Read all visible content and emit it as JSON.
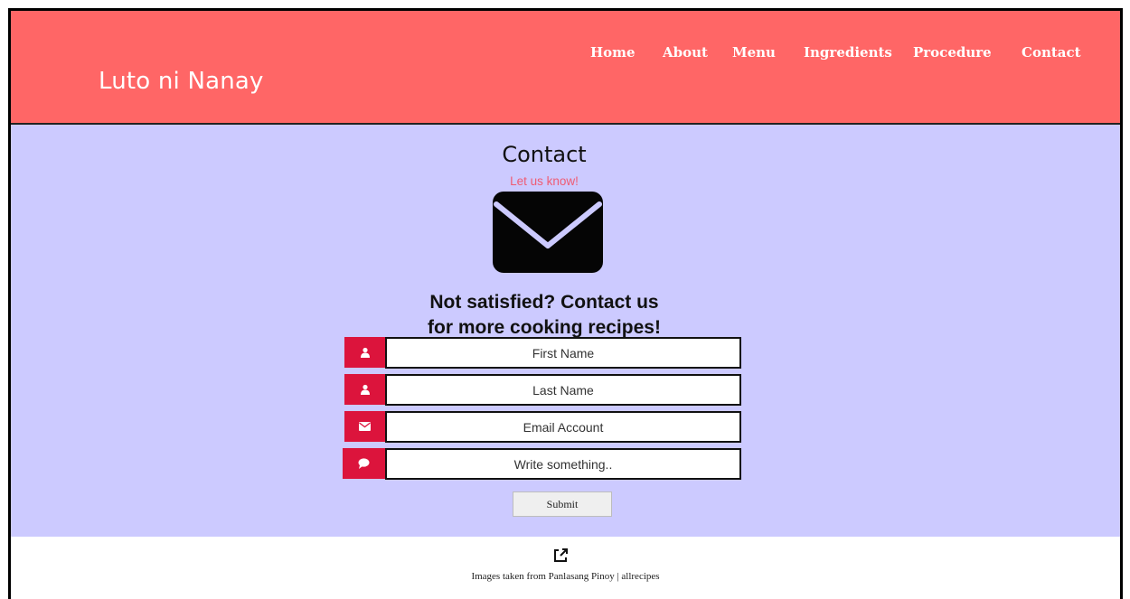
{
  "header": {
    "brand": "Luto ni Nanay",
    "nav": [
      "Home",
      "About",
      "Menu",
      "Ingredients",
      "Procedure",
      "Contact"
    ]
  },
  "contact": {
    "title": "Contact",
    "subtitle": "Let us know!",
    "tagline_line1": "Not satisfied? Contact us",
    "tagline_line2": "for more cooking recipes!"
  },
  "form": {
    "first_name_placeholder": "First Name",
    "last_name_placeholder": "Last Name",
    "email_placeholder": "Email Account",
    "message_placeholder": "Write something..",
    "submit_label": "Submit",
    "icons": [
      "user-icon",
      "user-icon",
      "envelope-icon",
      "comment-icon"
    ]
  },
  "footer": {
    "credit": "Images taken from Panlasang Pinoy | allrecipes",
    "icon": "external-link-icon"
  },
  "colors": {
    "header_bg": "#ff6666",
    "content_bg": "#cccaff",
    "accent": "#dc143c",
    "subtitle": "#ef5b73"
  }
}
